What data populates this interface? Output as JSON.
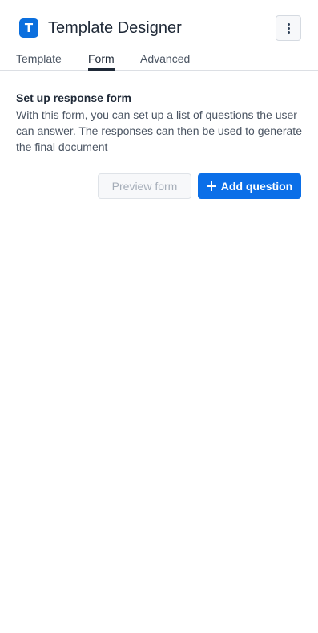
{
  "header": {
    "logo_letter": "T",
    "title": "Template Designer",
    "more_icon": "more-vertical-icon"
  },
  "tabs": [
    {
      "label": "Template",
      "active": false
    },
    {
      "label": "Form",
      "active": true
    },
    {
      "label": "Advanced",
      "active": false
    }
  ],
  "form_section": {
    "title": "Set up response form",
    "description": "With this form, you can set up a list of questions the user can answer. The responses can then be used to generate the final document"
  },
  "actions": {
    "preview_label": "Preview form",
    "preview_disabled": true,
    "add_label": "Add question",
    "add_icon": "plus-icon"
  },
  "colors": {
    "accent": "#0b6fe8",
    "logo": "#0b6fde",
    "text_primary": "#1f2937",
    "text_secondary": "#4b5563"
  }
}
